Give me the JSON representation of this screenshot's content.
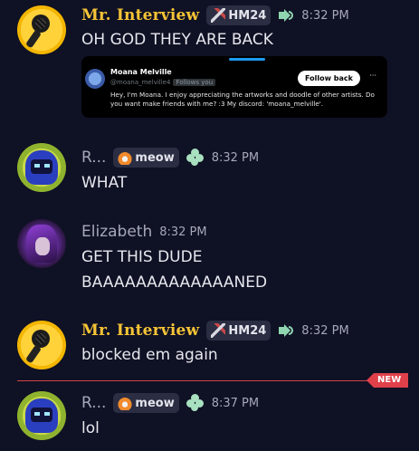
{
  "messages": [
    {
      "author": "Mr. Interview",
      "tag": "HM24",
      "time": "8:32 PM",
      "lines": [
        "OH GOD THEY ARE BACK"
      ],
      "embed": {
        "name": "Moana Melville",
        "handle": "@moana_melville4",
        "follows_you": "Follows you",
        "button": "Follow back",
        "menu": "···",
        "bio": "Hey, I'm Moana. I enjoy appreciating the artworks and doodle of other artists. Do you want make friends with me? :3 My discord: 'moana_melville'."
      }
    },
    {
      "author": "R...",
      "tag": "meow",
      "time": "8:32 PM",
      "lines": [
        "WHAT"
      ]
    },
    {
      "author": "Elizabeth",
      "time": "8:32 PM",
      "lines": [
        "GET THIS DUDE",
        "BAAAAAAAAAAAAANED"
      ]
    },
    {
      "author": "Mr. Interview",
      "tag": "HM24",
      "time": "8:32 PM",
      "lines": [
        "blocked em again"
      ]
    },
    {
      "author": "R...",
      "tag": "meow",
      "time": "8:37 PM",
      "lines": [
        "lol"
      ]
    }
  ],
  "new_divider": {
    "label": "NEW",
    "color": "#e0404a"
  },
  "colors": {
    "background": "#0f1124",
    "fancy_name": "#f6c436",
    "accent_green": "#8fd6b0"
  }
}
